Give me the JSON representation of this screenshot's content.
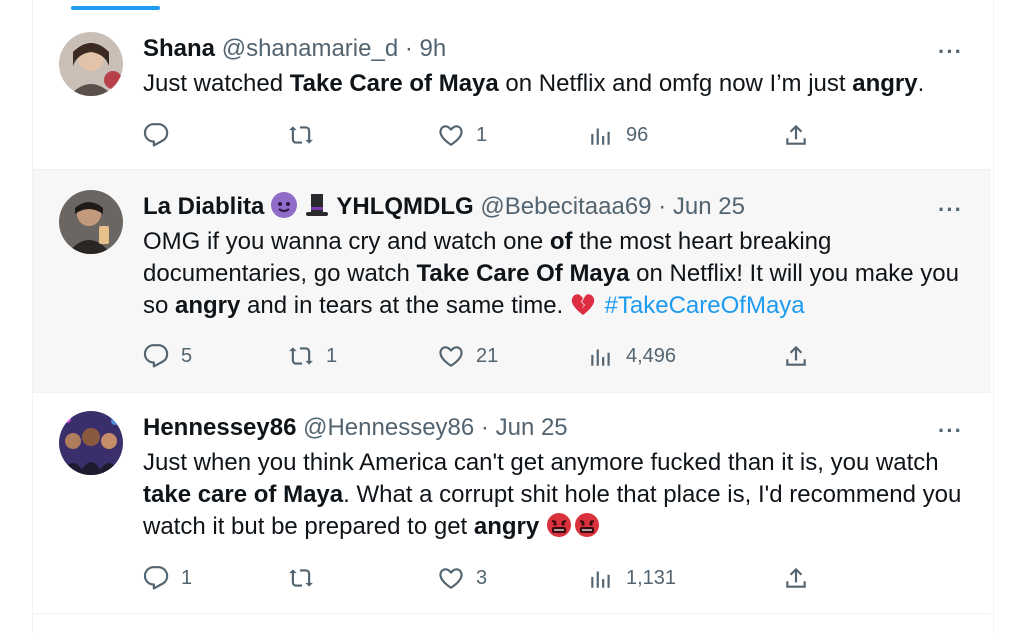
{
  "tweets": [
    {
      "name": "Shana",
      "handle": "@shanamarie_d",
      "separator": "·",
      "time": "9h",
      "more": "···",
      "body": [
        {
          "t": "Just watched "
        },
        {
          "t": "Take Care of Maya",
          "bold": true
        },
        {
          "t": " on Netflix and omfg now I’m just "
        },
        {
          "t": "angry",
          "bold": true
        },
        {
          "t": "."
        }
      ],
      "replies": "",
      "retweets": "",
      "likes": "1",
      "views": "96"
    },
    {
      "name": "La Diablita",
      "name_suffix": "YHLQMDLG",
      "name_emojis": [
        "smiling-devil-emoji",
        "top-hat-emoji"
      ],
      "handle": "@Bebecitaaa69",
      "separator": "·",
      "time": "Jun 25",
      "more": "···",
      "body": [
        {
          "t": "OMG if you wanna cry and watch one "
        },
        {
          "t": "of",
          "bold": true
        },
        {
          "t": " the most heart breaking documentaries, go watch "
        },
        {
          "t": "Take Care Of Maya",
          "bold": true
        },
        {
          "t": " on Netflix! It will you make you so "
        },
        {
          "t": "angry",
          "bold": true
        },
        {
          "t": " and in tears at the same time. "
        },
        {
          "emoji": "broken-heart-emoji"
        },
        {
          "t": " "
        },
        {
          "t": "#TakeCareOfMaya",
          "hashtag": true
        }
      ],
      "replies": "5",
      "retweets": "1",
      "likes": "21",
      "views": "4,496"
    },
    {
      "name": "Hennessey86",
      "handle": "@Hennessey86",
      "separator": "·",
      "time": "Jun 25",
      "more": "···",
      "body": [
        {
          "t": "Just when you think America can't get anymore fucked than it is, you watch "
        },
        {
          "t": "take care of Maya",
          "bold": true
        },
        {
          "t": ". What a corrupt shit hole that place is, I'd recommend you watch it but be prepared to get "
        },
        {
          "t": "angry",
          "bold": true
        },
        {
          "t": " "
        },
        {
          "emoji": "cursing-face-emoji"
        },
        {
          "emoji": "cursing-face-emoji"
        }
      ],
      "replies": "1",
      "retweets": "",
      "likes": "3",
      "views": "1,131"
    }
  ],
  "colors": {
    "accent": "#1d9bf0",
    "secondary_text": "#536471",
    "highlight_bg": "#f7f7f7"
  }
}
